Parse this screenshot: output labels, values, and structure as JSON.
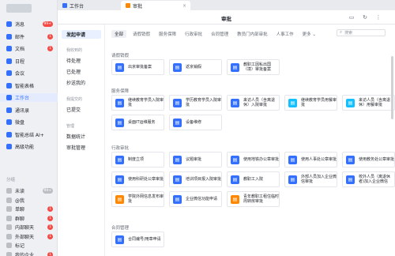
{
  "colors": {
    "accent": "#3370ff",
    "badge": "#f54a45",
    "icon_blue": "#3370ff",
    "icon_teal": "#14c0ff",
    "icon_orange": "#ff8800"
  },
  "sidebar": {
    "nav": [
      {
        "label": "消息",
        "badge": "99+",
        "icon": "chat-icon",
        "color": "#3370ff"
      },
      {
        "label": "邮件",
        "badge": "1",
        "icon": "mail-icon",
        "color": "#3370ff"
      },
      {
        "label": "文档",
        "badge": "1",
        "icon": "doc-icon",
        "color": "#3370ff"
      },
      {
        "label": "日程",
        "badge": "",
        "icon": "calendar-icon",
        "color": "#3370ff"
      },
      {
        "label": "会议",
        "badge": "",
        "icon": "video-icon",
        "color": "#3370ff"
      },
      {
        "label": "智能表格",
        "badge": "",
        "icon": "table-icon",
        "color": "#3370ff"
      },
      {
        "label": "工作台",
        "badge": "",
        "icon": "grid-icon",
        "color": "#3370ff"
      },
      {
        "label": "通讯录",
        "badge": "",
        "icon": "contacts-icon",
        "color": "#3370ff"
      },
      {
        "label": "微盘",
        "badge": "",
        "icon": "cloud-icon",
        "color": "#3370ff"
      },
      {
        "label": "智能总结 AI+",
        "badge": "",
        "icon": "ai-icon",
        "color": "#3370ff"
      },
      {
        "label": "高级功能",
        "badge": "",
        "icon": "star-icon",
        "color": "#3370ff"
      }
    ],
    "group_label": "分组",
    "groups": [
      {
        "label": "未读",
        "badge": "99+"
      },
      {
        "label": "@我",
        "badge": ""
      },
      {
        "label": "单聊",
        "badge": "1"
      },
      {
        "label": "群聊",
        "badge": "1"
      },
      {
        "label": "内部聊天",
        "badge": "1"
      },
      {
        "label": "外部聊天",
        "badge": "1"
      },
      {
        "label": "标记",
        "badge": ""
      },
      {
        "label": "我的企业",
        "badge": "1"
      }
    ]
  },
  "tabs": [
    {
      "label": "工作台",
      "active": false
    },
    {
      "label": "审批",
      "active": true
    }
  ],
  "header": {
    "title": "审批"
  },
  "submenu": {
    "launch": "发起申请",
    "group1": "我收到的",
    "pending": "待处理",
    "done": "已处理",
    "cc": "抄送我的",
    "group2": "我提交的",
    "submitted": "已提交",
    "group3": "管理",
    "stats": "数据统计",
    "manage": "审批管理"
  },
  "filters": [
    "全部",
    "请假销假",
    "服务保障",
    "行政审批",
    "合同管理",
    "教员门内部审批",
    "人事工作",
    "更多 ⌄"
  ],
  "search": {
    "placeholder": "搜索"
  },
  "sections": [
    {
      "title": "请假销假",
      "items": [
        {
          "label": "出京审批备案",
          "color": "#3370ff"
        },
        {
          "label": "返京销假",
          "color": "#3370ff"
        },
        {
          "label": "教职工因私出国（境）审批备案",
          "color": "#3370ff"
        }
      ]
    },
    {
      "title": "服务保障",
      "items": [
        {
          "label": "继续教育学员入院审批",
          "color": "#3370ff"
        },
        {
          "label": "学历教育学员入院审批",
          "color": "#3370ff"
        },
        {
          "label": "来访人员（含离退休）入院审批",
          "color": "#3370ff"
        },
        {
          "label": "继续教育学员用餐审批",
          "color": "#14c0ff"
        },
        {
          "label": "来访人员（含离退休）用餐审批",
          "color": "#14c0ff"
        },
        {
          "label": "桌面IT运维服务",
          "color": "#3370ff"
        },
        {
          "label": "设备维修",
          "color": "#3370ff"
        }
      ]
    },
    {
      "title": "行政审批",
      "items": [
        {
          "label": "制度立项",
          "color": "#3370ff"
        },
        {
          "label": "议题审批",
          "color": "#3370ff"
        },
        {
          "label": "使用地铁办公章审批",
          "color": "#3370ff"
        },
        {
          "label": "使用人事处公章审批",
          "color": "#3370ff"
        },
        {
          "label": "使用教务处公章审批",
          "color": "#3370ff"
        },
        {
          "label": "使用科研处公章审批",
          "color": "#3370ff"
        },
        {
          "label": "培训项目报入院审批",
          "color": "#3370ff"
        },
        {
          "label": "教职工入院",
          "color": "#3370ff"
        },
        {
          "label": "外部人员加入企业微信审批",
          "color": "#3370ff"
        },
        {
          "label": "校外人员（离退休者)加入企业微信",
          "color": "#3370ff"
        },
        {
          "label": "学院外网信息发布审批",
          "color": "#ff8800"
        },
        {
          "label": "企业微信功能申请",
          "color": "#3370ff"
        },
        {
          "label": "青年教职工租住临时周转房审批",
          "color": "#ff8800"
        }
      ]
    },
    {
      "title": "合同管理",
      "items": [
        {
          "label": "合同编号/用章申请",
          "color": "#3370ff"
        }
      ]
    }
  ]
}
